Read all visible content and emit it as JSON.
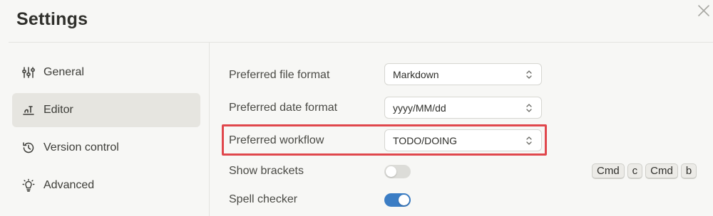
{
  "header": {
    "title": "Settings"
  },
  "sidebar": {
    "items": [
      {
        "label": "General",
        "icon": "sliders-icon",
        "active": false
      },
      {
        "label": "Editor",
        "icon": "editor-icon",
        "active": true
      },
      {
        "label": "Version control",
        "icon": "history-icon",
        "active": false
      },
      {
        "label": "Advanced",
        "icon": "lightbulb-icon",
        "active": false
      }
    ]
  },
  "editor": {
    "file_format": {
      "label": "Preferred file format",
      "value": "Markdown"
    },
    "date_format": {
      "label": "Preferred date format",
      "value": "yyyy/MM/dd"
    },
    "workflow": {
      "label": "Preferred workflow",
      "value": "TODO/DOING"
    },
    "show_brackets": {
      "label": "Show brackets",
      "enabled": false
    },
    "spell_checker": {
      "label": "Spell checker",
      "enabled": true
    },
    "shortcut_keys": [
      "Cmd",
      "c",
      "Cmd",
      "b"
    ]
  },
  "colors": {
    "highlight": "#e0474c",
    "toggle_on": "#3b7dc4",
    "toggle_off": "#dcdcd8"
  }
}
